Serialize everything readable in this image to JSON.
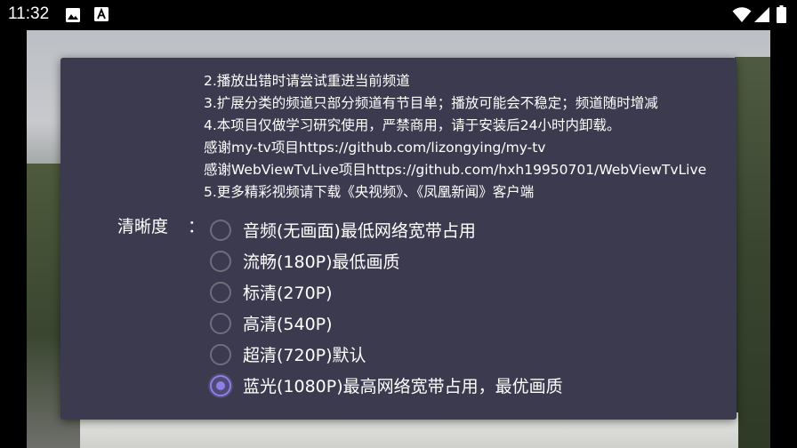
{
  "status_bar": {
    "time": "11:32",
    "left_icons": [
      "image-icon",
      "a-letter-icon"
    ],
    "right_icons": [
      "wifi-icon",
      "signal-icon",
      "battery-icon"
    ]
  },
  "dialog": {
    "notes": [
      "2.播放出错时请尝试重进当前频道",
      "3.扩展分类的频道只部分频道有节目单；播放可能会不稳定；频道随时增减",
      "4.本项目仅做学习研究使用，严禁商用，请于安装后24小时内卸载。",
      "感谢my-tv项目https://github.com/lizongying/my-tv",
      "感谢WebViewTvLive项目https://github.com/hxh19950701/WebViewTvLive",
      "5.更多精彩视频请下载《央视频》、《凤凰新闻》客户端"
    ],
    "quality_label": "清晰度",
    "quality_colon": "：",
    "options": [
      {
        "label": "音频(无画面)最低网络宽带占用",
        "selected": false
      },
      {
        "label": "流畅(180P)最低画质",
        "selected": false
      },
      {
        "label": "标清(270P)",
        "selected": false
      },
      {
        "label": "高清(540P)",
        "selected": false
      },
      {
        "label": "超清(720P)默认",
        "selected": false
      },
      {
        "label": "蓝光(1080P)最高网络宽带占用，最优画质",
        "selected": true
      }
    ]
  },
  "colors": {
    "dialog_bg": "#3c3a4e",
    "accent": "#8d7fe6",
    "radio_unselected": "#6f6c7c"
  }
}
